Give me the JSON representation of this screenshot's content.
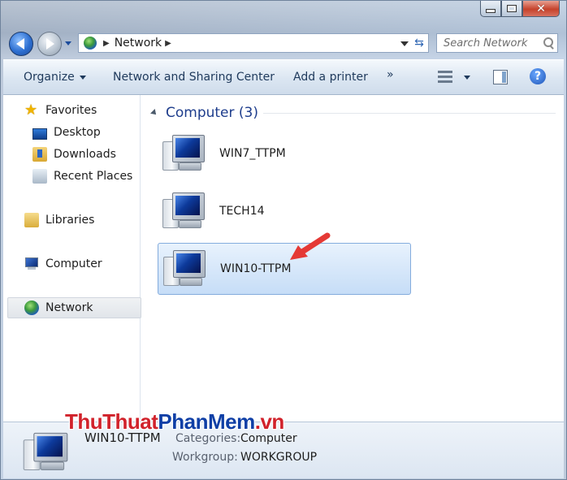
{
  "window": {
    "address_crumb": "Network",
    "search_placeholder": "Search Network"
  },
  "toolbar": {
    "organize": "Organize",
    "network_sharing": "Network and Sharing Center",
    "add_printer": "Add a printer",
    "more": "»"
  },
  "sidebar": {
    "favorites": "Favorites",
    "desktop": "Desktop",
    "downloads": "Downloads",
    "recent_places": "Recent Places",
    "libraries": "Libraries",
    "computer": "Computer",
    "network": "Network"
  },
  "main": {
    "group_header": "Computer (3)",
    "items": [
      {
        "name": "WIN7_TTPM"
      },
      {
        "name": "TECH14"
      },
      {
        "name": "WIN10-TTPM"
      }
    ]
  },
  "details": {
    "name": "WIN10-TTPM",
    "categories_label": "Categories:",
    "categories_value": "Computer",
    "workgroup_label": "Workgroup:",
    "workgroup_value": "WORKGROUP"
  },
  "watermark": {
    "part1": "ThuThuat",
    "part2": "PhanMem",
    "part3": ".vn"
  },
  "colors": {
    "selection": "#c6ddf7",
    "link": "#1e3d8c",
    "annotation_arrow": "#e53935"
  }
}
